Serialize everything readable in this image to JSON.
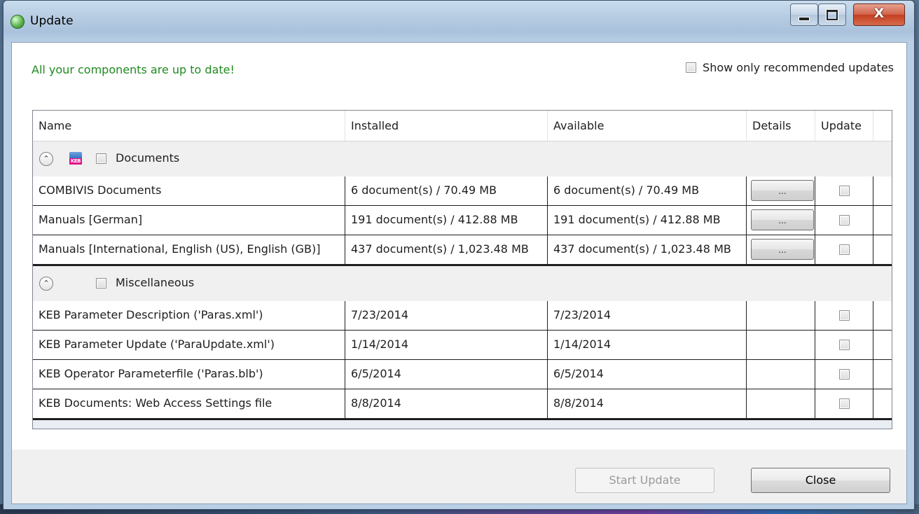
{
  "window": {
    "title": "Update",
    "close_glyph": "X"
  },
  "status_message": "All your components are up to date!",
  "recommended_label": "Show only recommended updates",
  "table": {
    "headers": {
      "name": "Name",
      "installed": "Installed",
      "available": "Available",
      "details": "Details",
      "update": "Update"
    },
    "details_button_label": "...",
    "groups": [
      {
        "label": "Documents",
        "expander_glyph": "⌃",
        "icon": "keb-documents-icon",
        "icon_text": "KEB",
        "rows": [
          {
            "name": "COMBIVIS Documents",
            "installed": "6 document(s) / 70.49 MB",
            "available": "6 document(s) / 70.49 MB"
          },
          {
            "name": "Manuals [German]",
            "installed": "191 document(s) / 412.88 MB",
            "available": "191 document(s) / 412.88 MB"
          },
          {
            "name": "Manuals [International, English (US), English (GB)]",
            "installed": "437 document(s) / 1,023.48 MB",
            "available": "437 document(s) / 1,023.48 MB"
          }
        ]
      },
      {
        "label": "Miscellaneous",
        "expander_glyph": "⌃",
        "rows": [
          {
            "name": "KEB Parameter Description ('Paras.xml')",
            "installed": "7/23/2014",
            "available": "7/23/2014"
          },
          {
            "name": "KEB Parameter Update ('ParaUpdate.xml')",
            "installed": "1/14/2014",
            "available": "1/14/2014"
          },
          {
            "name": "KEB Operator Parameterfile ('Paras.blb')",
            "installed": "6/5/2014",
            "available": "6/5/2014"
          },
          {
            "name": "KEB Documents: Web Access Settings file",
            "installed": "8/8/2014",
            "available": "8/8/2014"
          }
        ]
      }
    ]
  },
  "buttons": {
    "start_update": "Start Update",
    "close": "Close"
  },
  "colors": {
    "status_green": "#1f8a1f",
    "keb_magenta": "#e0168a"
  }
}
